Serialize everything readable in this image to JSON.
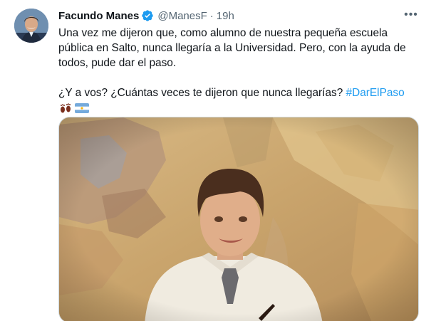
{
  "author": {
    "name": "Facundo Manes",
    "handle": "@ManesF",
    "separator": "·",
    "time": "19h",
    "verified": true,
    "avatar_icon": "profile-photo"
  },
  "more_icon": "more-horizontal-icon",
  "tweet": {
    "line1": "Una vez me dijeron que, como alumno de nuestra pequeña escuela",
    "line2": "pública en Salto, nunca llegaría a la Universidad. Pero, con la ayuda de",
    "line3": "todos, pude dar el paso.",
    "question": "¿Y a vos? ¿Cuántas veces te dijeron que nunca llegarías? ",
    "hashtag": "#DarElPaso",
    "emojis": [
      "footprints",
      "flag-argentina"
    ]
  },
  "media": {
    "type": "photo",
    "subject": "boy in white school smock in front of map"
  },
  "colors": {
    "text": "#0f1419",
    "secondary": "#536471",
    "link": "#1d9bf0",
    "verified": "#1d9bf0",
    "border": "#cfd9de"
  }
}
